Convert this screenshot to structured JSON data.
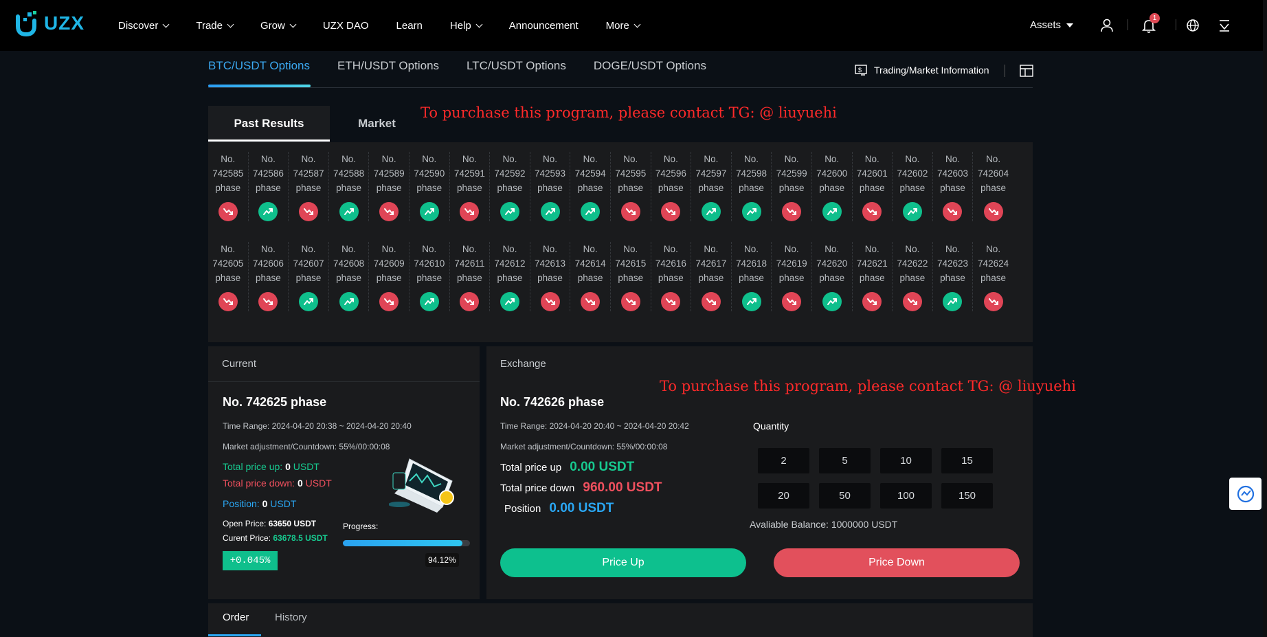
{
  "nav": {
    "logo_text": "UZX",
    "items": [
      {
        "label": "Discover",
        "dropdown": true
      },
      {
        "label": "Trade",
        "dropdown": true
      },
      {
        "label": "Grow",
        "dropdown": true
      },
      {
        "label": "UZX DAO",
        "dropdown": false
      },
      {
        "label": "Learn",
        "dropdown": false
      },
      {
        "label": "Help",
        "dropdown": true
      },
      {
        "label": "Announcement",
        "dropdown": false
      },
      {
        "label": "More",
        "dropdown": true
      }
    ],
    "assets_label": "Assets",
    "notification_count": "1"
  },
  "pair_tabs": [
    "BTC/USDT Options",
    "ETH/USDT Options",
    "LTC/USDT Options",
    "DOGE/USDT Options"
  ],
  "trading_info_label": "Trading/Market Information",
  "results_tabs": {
    "active": "Past Results",
    "inactive": "Market"
  },
  "promo_text": "To purchase this program, please contact TG: @ liuyuehi",
  "phase_prefix": "No.",
  "phase_suffix": "phase",
  "past_results": [
    [
      {
        "id": "742585",
        "dir": "down"
      },
      {
        "id": "742586",
        "dir": "up"
      },
      {
        "id": "742587",
        "dir": "down"
      },
      {
        "id": "742588",
        "dir": "up"
      },
      {
        "id": "742589",
        "dir": "down"
      },
      {
        "id": "742590",
        "dir": "up"
      },
      {
        "id": "742591",
        "dir": "down"
      },
      {
        "id": "742592",
        "dir": "up"
      },
      {
        "id": "742593",
        "dir": "up"
      },
      {
        "id": "742594",
        "dir": "up"
      },
      {
        "id": "742595",
        "dir": "down"
      },
      {
        "id": "742596",
        "dir": "down"
      },
      {
        "id": "742597",
        "dir": "up"
      },
      {
        "id": "742598",
        "dir": "up"
      },
      {
        "id": "742599",
        "dir": "down"
      },
      {
        "id": "742600",
        "dir": "up"
      },
      {
        "id": "742601",
        "dir": "down"
      },
      {
        "id": "742602",
        "dir": "up"
      },
      {
        "id": "742603",
        "dir": "down"
      },
      {
        "id": "742604",
        "dir": "down"
      }
    ],
    [
      {
        "id": "742605",
        "dir": "down"
      },
      {
        "id": "742606",
        "dir": "down"
      },
      {
        "id": "742607",
        "dir": "up"
      },
      {
        "id": "742608",
        "dir": "up"
      },
      {
        "id": "742609",
        "dir": "down"
      },
      {
        "id": "742610",
        "dir": "up"
      },
      {
        "id": "742611",
        "dir": "down"
      },
      {
        "id": "742612",
        "dir": "up"
      },
      {
        "id": "742613",
        "dir": "down"
      },
      {
        "id": "742614",
        "dir": "down"
      },
      {
        "id": "742615",
        "dir": "down"
      },
      {
        "id": "742616",
        "dir": "down"
      },
      {
        "id": "742617",
        "dir": "down"
      },
      {
        "id": "742618",
        "dir": "up"
      },
      {
        "id": "742619",
        "dir": "down"
      },
      {
        "id": "742620",
        "dir": "up"
      },
      {
        "id": "742621",
        "dir": "down"
      },
      {
        "id": "742622",
        "dir": "down"
      },
      {
        "id": "742623",
        "dir": "up"
      },
      {
        "id": "742624",
        "dir": "down"
      }
    ]
  ],
  "current": {
    "header": "Current",
    "phase_title": "No. 742625 phase",
    "time_range": "Time Range: 2024-04-20 20:38 ~ 2024-04-20 20:40",
    "countdown": "Market adjustment/Countdown: 55%/00:00:08",
    "total_up_label": "Total price up: ",
    "total_up_value": "0",
    "total_down_label": "Total price down: ",
    "total_down_value": "0",
    "position_label": "Position: ",
    "position_value": "0",
    "unit": " USDT",
    "open_price_label": "Open Price: ",
    "open_price_value": "63650 USDT",
    "current_price_label": "Curent Price: ",
    "current_price_value": "63678.5 USDT",
    "progress_label": "Progress:",
    "progress_percent": 94.12,
    "progress_text": "94.12%",
    "change_badge": "+0.045%"
  },
  "exchange": {
    "header": "Exchange",
    "phase_title": "No. 742626 phase",
    "time_range": "Time Range: 2024-04-20 20:40 ~ 2024-04-20 20:42",
    "countdown": "Market adjustment/Countdown: 55%/00:00:08",
    "total_up_label": "Total price up",
    "total_up_value": "0.00 USDT",
    "total_down_label": "Total price down",
    "total_down_value": "960.00 USDT",
    "position_label": "Position",
    "position_value": "0.00 USDT",
    "quantity_label": "Quantity",
    "quantities": [
      "2",
      "5",
      "10",
      "15",
      "20",
      "50",
      "100",
      "150"
    ],
    "balance": "Avaliable Balance: 1000000 USDT",
    "price_up_label": "Price Up",
    "price_down_label": "Price Down"
  },
  "order_tabs": [
    "Order",
    "History"
  ],
  "colors": {
    "up": "#0fbf8c",
    "down": "#e04556",
    "accent": "#2aa6f2"
  }
}
